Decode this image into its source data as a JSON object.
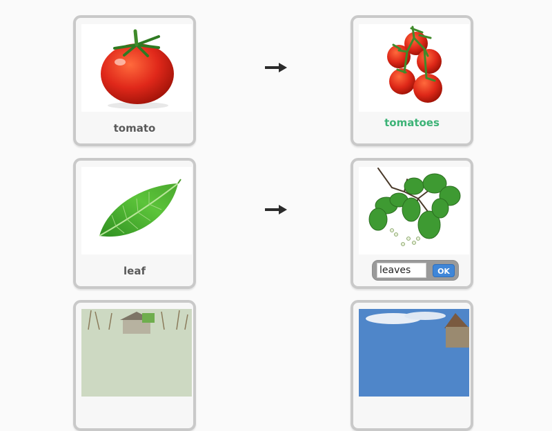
{
  "rows": [
    {
      "singular": {
        "label": "tomato",
        "image": "tomato-photo"
      },
      "arrow": "right-arrow-icon",
      "plural": {
        "label": "tomatoes",
        "image": "tomatoes-photo",
        "state": "answered-correct"
      }
    },
    {
      "singular": {
        "label": "leaf",
        "image": "leaf-photo"
      },
      "arrow": "right-arrow-icon",
      "plural": {
        "image": "leaves-photo",
        "state": "input",
        "input_value": "leaves",
        "ok_label": "OK"
      }
    },
    {
      "singular": {
        "image": "house-photo"
      },
      "plural": {
        "image": "houses-photo"
      }
    }
  ],
  "colors": {
    "correct": "#3db377",
    "ok_button": "#3f86d8",
    "card_border": "#c9c9c9"
  }
}
